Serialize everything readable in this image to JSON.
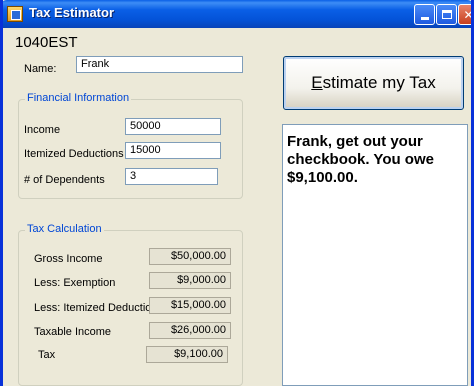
{
  "window": {
    "title": "Tax Estimator",
    "min_glyph": "",
    "max_glyph": "",
    "close_glyph": "✕",
    "accent": "#0a5fe6"
  },
  "heading": "1040EST",
  "name": {
    "label": "Name:",
    "value": "Frank"
  },
  "financial": {
    "title": "Financial Information",
    "income": {
      "label": "Income",
      "value": "50000"
    },
    "itemized": {
      "label": "Itemized Deductions",
      "value": "15000"
    },
    "dependents": {
      "label": "# of Dependents",
      "value": "3"
    }
  },
  "calc": {
    "title": "Tax Calculation",
    "gross": {
      "label": "Gross Income",
      "value": "$50,000.00"
    },
    "exemption": {
      "label": "Less: Exemption",
      "value": "$9,000.00"
    },
    "itemized": {
      "label": "Less: Itemized Deductions",
      "value": "$15,000.00"
    },
    "taxable": {
      "label": "Taxable Income",
      "value": "$26,000.00"
    },
    "tax": {
      "label": "Tax",
      "value": "$9,100.00"
    }
  },
  "estimate_button": {
    "mnemonic": "E",
    "rest": "stimate my Tax"
  },
  "output_text": "Frank, get out your checkbook.  You owe $9,100.00."
}
